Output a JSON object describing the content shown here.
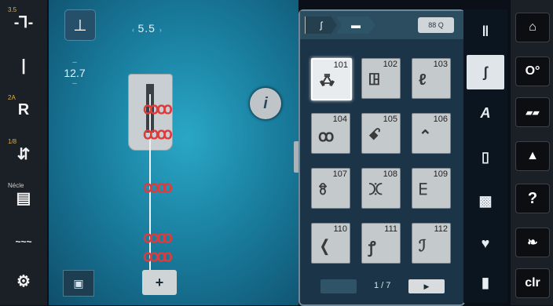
{
  "left_bar": {
    "items": [
      {
        "label": "3.5",
        "icon": "needle-position-icon",
        "glyph": "-Ꞁ-"
      },
      {
        "label": "",
        "icon": "needle-icon",
        "glyph": "|"
      },
      {
        "label": "2A",
        "icon": "presser-foot-icon",
        "glyph": "R"
      },
      {
        "label": "1/8",
        "icon": "tension-icon",
        "glyph": "⇵"
      },
      {
        "label": "Nécle",
        "icon": "needle-plate-icon",
        "glyph": "▤"
      },
      {
        "label": "",
        "icon": "feed-dog-icon",
        "glyph": "~~~"
      },
      {
        "label": "",
        "icon": "settings-gear-icon",
        "glyph": "⚙"
      }
    ]
  },
  "main": {
    "stitch_width": "5.5",
    "stitch_length": "12.7",
    "length_minus": "–",
    "length_plus": "–",
    "info_label": "i",
    "plus_label": "+",
    "motif_glyph": "ꝏꝏ"
  },
  "panel": {
    "breadcrumb_1": "ʃ",
    "breadcrumb_2": "▬",
    "search_label": "88 Q",
    "stitches": [
      {
        "num": "101",
        "glyph": "ꗈ"
      },
      {
        "num": "102",
        "glyph": "ꖸ"
      },
      {
        "num": "103",
        "glyph": "ℓ"
      },
      {
        "num": "104",
        "glyph": "ꝏ"
      },
      {
        "num": "105",
        "glyph": "ꗃ"
      },
      {
        "num": "106",
        "glyph": "⌃"
      },
      {
        "num": "107",
        "glyph": "ꗉ"
      },
      {
        "num": "108",
        "glyph": "ꖼ"
      },
      {
        "num": "109",
        "glyph": "ꗋ"
      },
      {
        "num": "110",
        "glyph": "❬"
      },
      {
        "num": "111",
        "glyph": "ꝭ"
      },
      {
        "num": "112",
        "glyph": "ℐ"
      }
    ],
    "selected_index": 0,
    "page": "1 / 7",
    "next_label": "▶"
  },
  "categories": [
    {
      "name": "practical-stitches-icon",
      "glyph": "‖"
    },
    {
      "name": "decorative-stitches-icon",
      "glyph": "ʃ"
    },
    {
      "name": "alphabets-icon",
      "glyph": "A"
    },
    {
      "name": "buttonholes-icon",
      "glyph": "▯"
    },
    {
      "name": "quilt-stitches-icon",
      "glyph": "▩"
    },
    {
      "name": "personal-program-icon",
      "glyph": "♥"
    },
    {
      "name": "memory-icon",
      "glyph": "▮"
    }
  ],
  "right_bar": {
    "items": [
      {
        "name": "home-icon",
        "glyph": "⌂"
      },
      {
        "name": "setup-icon",
        "glyph": "O°"
      },
      {
        "name": "tutorial-icon",
        "glyph": "▰▰"
      },
      {
        "name": "creative-consultant-icon",
        "glyph": "▲"
      },
      {
        "name": "help-icon",
        "glyph": "?"
      },
      {
        "name": "eco-icon",
        "glyph": "❧"
      },
      {
        "name": "clr-button",
        "glyph": "clr"
      }
    ]
  }
}
